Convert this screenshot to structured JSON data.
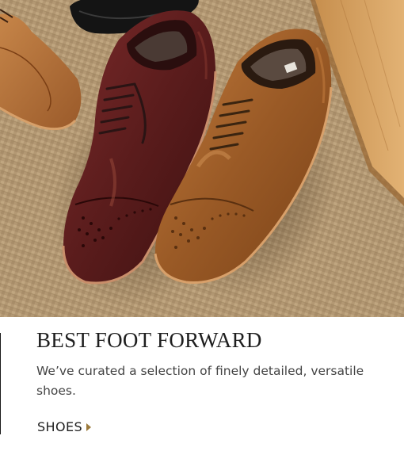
{
  "promo": {
    "image_alt": "Two cap-toe brogue dress shoes, burgundy and tan, on a sisal rug",
    "headline": "BEST FOOT FORWARD",
    "description": "We’ve curated a selection of finely detailed, versatile shoes.",
    "cta_label": "SHOES",
    "cta_icon": "caret-right-icon"
  },
  "colors": {
    "accent": "#9c7a3c",
    "headline": "#1e1e1e",
    "body_text": "#444444",
    "rug": "#b49a74",
    "burgundy_leather": "#5a1c1c",
    "tan_leather": "#9a5a26"
  }
}
